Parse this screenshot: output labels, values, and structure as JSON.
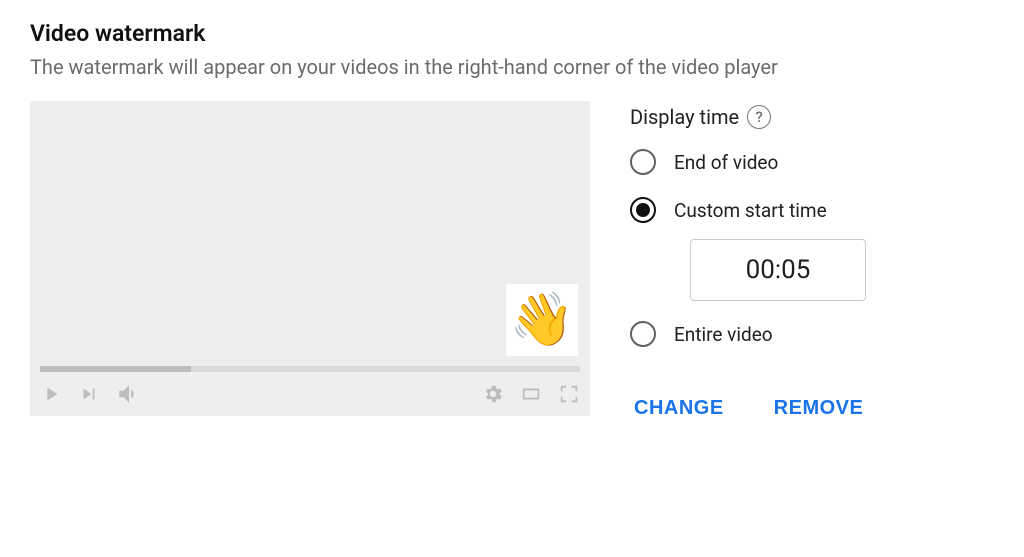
{
  "section": {
    "title": "Video watermark",
    "description": "The watermark will appear on your videos in the right-hand corner of the video player"
  },
  "preview": {
    "watermark_emoji": "👋"
  },
  "display_time": {
    "label": "Display time",
    "help_symbol": "?",
    "options": {
      "end": "End of video",
      "custom": "Custom start time",
      "entire": "Entire video"
    },
    "selected": "custom",
    "custom_time_value": "00:05"
  },
  "actions": {
    "change": "CHANGE",
    "remove": "REMOVE"
  }
}
